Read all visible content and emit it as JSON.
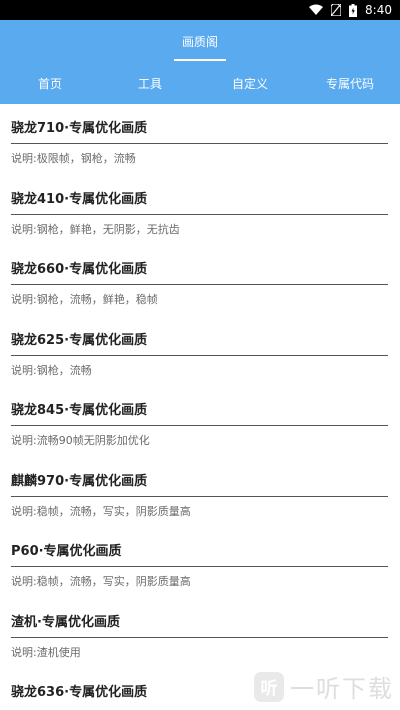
{
  "status_bar": {
    "time": "8:40",
    "icons": [
      "wifi-icon",
      "no-sim-icon",
      "battery-icon"
    ]
  },
  "header": {
    "title": "画质阁"
  },
  "tabs": [
    {
      "label": "首页"
    },
    {
      "label": "工具"
    },
    {
      "label": "自定义"
    },
    {
      "label": "专属代码"
    }
  ],
  "items": [
    {
      "title": "骁龙710·专属优化画质",
      "desc": "说明:极限帧，钢枪，流畅"
    },
    {
      "title": "骁龙410·专属优化画质",
      "desc": "说明:钢枪，鲜艳，无阴影，无抗齿"
    },
    {
      "title": "骁龙660·专属优化画质",
      "desc": "说明:钢枪，流畅，鲜艳，稳帧"
    },
    {
      "title": "骁龙625·专属优化画质",
      "desc": "说明:钢枪，流畅"
    },
    {
      "title": "骁龙845·专属优化画质",
      "desc": "说明:流畅90帧无阴影加优化"
    },
    {
      "title": "麒麟970·专属优化画质",
      "desc": "说明:稳帧，流畅，写实，阴影质量高"
    },
    {
      "title": "P60·专属优化画质",
      "desc": "说明:稳帧，流畅，写实，阴影质量高"
    },
    {
      "title": "渣机·专属优化画质",
      "desc": "说明:渣机使用"
    },
    {
      "title": "骁龙636·专属优化画质",
      "desc": ""
    }
  ],
  "watermark": {
    "logo_char": "听",
    "text": "一听下载"
  },
  "colors": {
    "header_bg": "#5aaaf0",
    "status_bar_bg": "#000000"
  }
}
